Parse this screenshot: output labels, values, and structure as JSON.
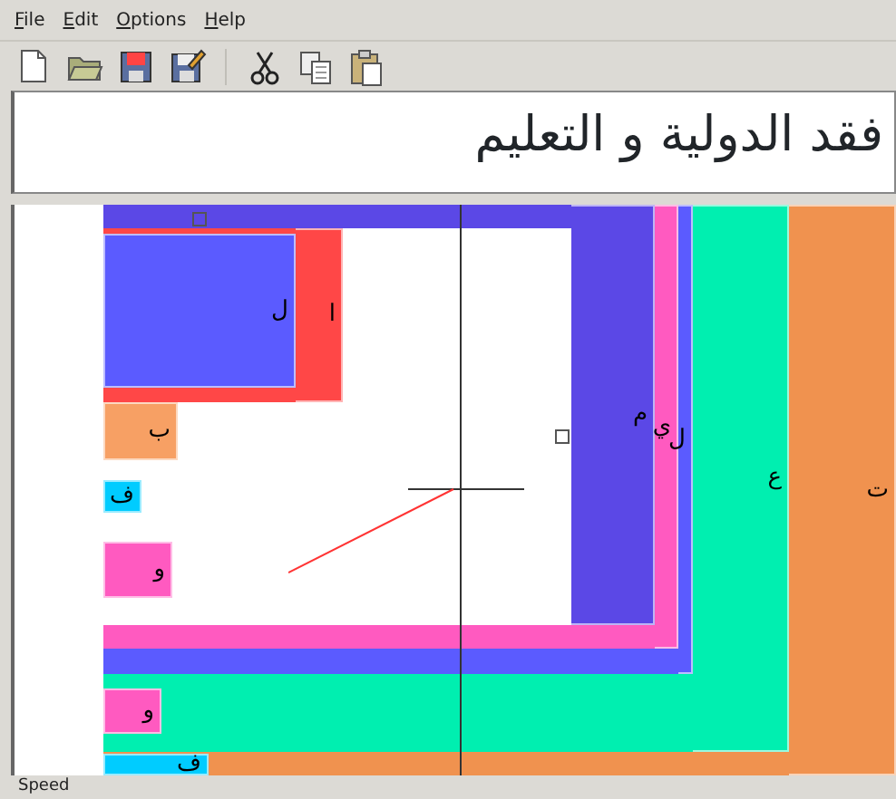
{
  "menu": [
    "File",
    "Edit",
    "Options",
    "Help"
  ],
  "text_area": {
    "value": "فقد الدولية و التعليم"
  },
  "boxes": [
    {
      "letter": "ت",
      "color": "#f0924f",
      "children": [
        {
          "letter": "ع",
          "color": "#00efb0",
          "children": [
            {
              "letter": "ل",
              "color": "#5b5bff",
              "children": [
                {
                  "letter": "ي",
                  "color": "#ff5ac0",
                  "children": [
                    {
                      "letter": "م",
                      "color": "#5b48e6",
                      "children": [
                        {
                          "children": [
                            {
                              "letter": "ا",
                              "color": "#ff4747",
                              "children": [
                                {
                                  "letter": "ل",
                                  "color": "#5b5bff"
                                }
                              ]
                            },
                            {
                              "letter": "ب",
                              "color": "#f7a064"
                            },
                            {
                              "letter": "ف",
                              "color": "#00ccff"
                            },
                            {
                              "letter": "و",
                              "color": "#ff5ac0"
                            }
                          ]
                        }
                      ]
                    }
                  ]
                }
              ]
            },
            {
              "letter": "و",
              "color": "#ff5ac0"
            }
          ]
        },
        {
          "letter": "ف",
          "color": "#00ccff"
        }
      ]
    }
  ],
  "status": {
    "speed_label": "Speed"
  }
}
